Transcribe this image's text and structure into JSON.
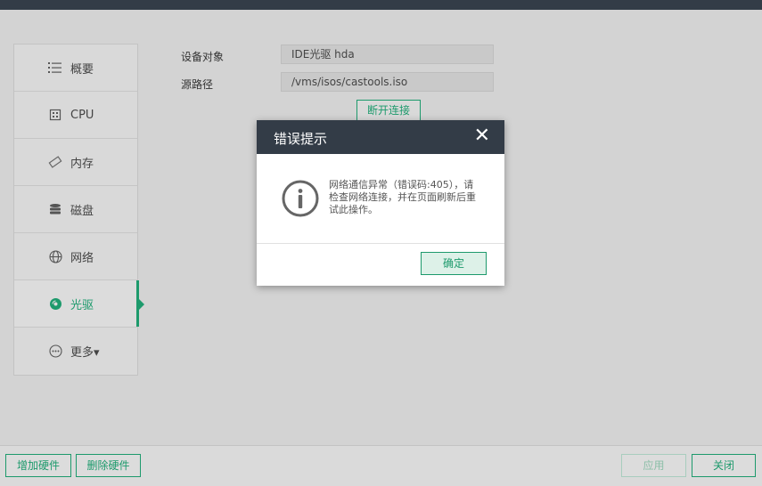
{
  "sidebar": {
    "items": [
      {
        "label": "概要",
        "icon": "list-icon"
      },
      {
        "label": "CPU",
        "icon": "cpu-icon"
      },
      {
        "label": "内存",
        "icon": "memory-icon"
      },
      {
        "label": "磁盘",
        "icon": "disk-icon"
      },
      {
        "label": "网络",
        "icon": "globe-icon"
      },
      {
        "label": "光驱",
        "icon": "cdrom-icon",
        "active": true
      },
      {
        "label": "更多▾",
        "icon": "more-icon"
      }
    ]
  },
  "form": {
    "device_label": "设备对象",
    "device_value": "IDE光驱 hda",
    "source_label": "源路径",
    "source_value": "/vms/isos/castools.iso",
    "disconnect_label": "断开连接"
  },
  "footer": {
    "add_hw": "增加硬件",
    "remove_hw": "删除硬件",
    "apply": "应用",
    "close": "关闭"
  },
  "modal": {
    "title": "错误提示",
    "close_glyph": "✕",
    "message": "网络通信异常（错误码:405），请检查网络连接，并在页面刷新后重试此操作。",
    "ok": "确定"
  },
  "colors": {
    "accent": "#1d9a6c",
    "header_dark": "#333c47"
  }
}
